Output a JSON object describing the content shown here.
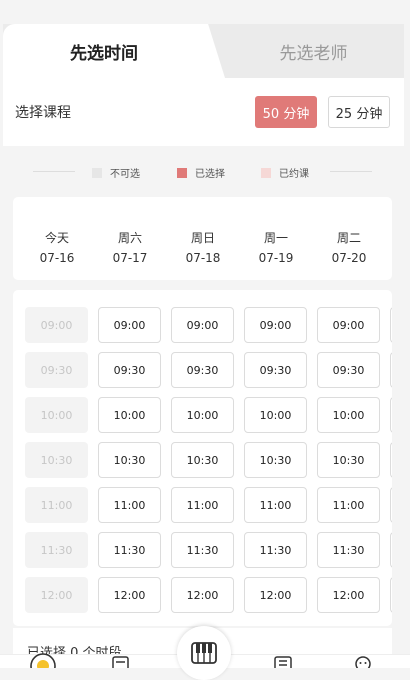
{
  "tabs": {
    "active": "先选时间",
    "inactive": "先选老师"
  },
  "course": {
    "label": "选择课程",
    "options": [
      {
        "label": "50 分钟",
        "selected": true
      },
      {
        "label": "25 分钟",
        "selected": false
      }
    ]
  },
  "legend": [
    {
      "label": "不可选",
      "color": "#e6e6e6"
    },
    {
      "label": "已选择",
      "color": "#e07a78"
    },
    {
      "label": "已约课",
      "color": "#f6d8d6"
    }
  ],
  "dates": [
    {
      "weekday": "今天",
      "date": "07-16"
    },
    {
      "weekday": "周六",
      "date": "07-17"
    },
    {
      "weekday": "周日",
      "date": "07-18"
    },
    {
      "weekday": "周一",
      "date": "07-19"
    },
    {
      "weekday": "周二",
      "date": "07-20"
    }
  ],
  "times": [
    "09:00",
    "09:30",
    "10:00",
    "10:30",
    "11:00",
    "11:30",
    "12:00"
  ],
  "summary": "已选择 0 个时段",
  "colors": {
    "accent": "#e07a78",
    "background": "#f4f4f4"
  }
}
